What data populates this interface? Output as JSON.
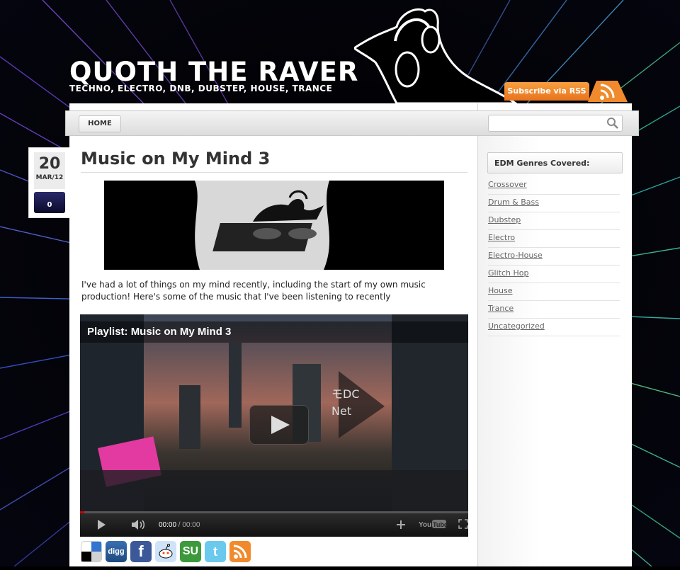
{
  "site": {
    "title": "QUOTH THE RAVER",
    "tagline": "TECHNO, ELECTRO, DNB, DUBSTEP, HOUSE, TRANCE",
    "rss_label": "Subscribe via RSS"
  },
  "nav": {
    "items": [
      {
        "label": "HOME"
      }
    ],
    "search": {
      "placeholder": "",
      "value": "",
      "icon": "search-icon"
    }
  },
  "post": {
    "date_day": "20",
    "date_month_year": "MAR/12",
    "comment_count": "0",
    "title": "Music on My Mind 3",
    "body": "I've had a lot of things on my mind recently, including the start of my own music production! Here's some of the music that I've been listening to recently",
    "video": {
      "title": "Playlist: Music on My Mind 3",
      "current_time": "00:00",
      "separator": " / ",
      "duration": "00:00",
      "progress": 0
    },
    "share_icons": [
      "delicious-icon",
      "digg-icon",
      "facebook-icon",
      "reddit-icon",
      "stumbleupon-icon",
      "twitter-icon",
      "rss-icon"
    ],
    "share_labels": {
      "digg": "digg"
    }
  },
  "sidebar": {
    "widget_title": "EDM Genres Covered:",
    "categories": [
      "Crossover",
      "Drum & Bass",
      "Dubstep",
      "Electro",
      "Electro-House",
      "Glitch Hop",
      "House",
      "Trance",
      "Uncategorized"
    ]
  },
  "colors": {
    "accent_orange": "#f08a2c",
    "link_gray": "#666666",
    "comment_badge": "#1a1a4a"
  }
}
